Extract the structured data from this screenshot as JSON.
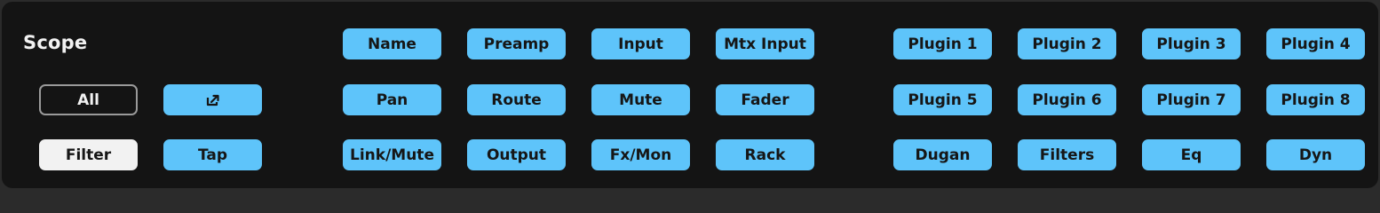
{
  "scope": {
    "title": "Scope"
  },
  "left_buttons": {
    "all": "All",
    "popout_icon": "popout-icon",
    "filter": "Filter",
    "tap": "Tap"
  },
  "grid": {
    "rows": [
      [
        "Name",
        "Preamp",
        "Input",
        "Mtx Input"
      ],
      [
        "Pan",
        "Route",
        "Mute",
        "Fader"
      ],
      [
        "Link/Mute",
        "Output",
        "Fx/Mon",
        "Rack"
      ]
    ]
  },
  "plugins": {
    "rows": [
      [
        "Plugin 1",
        "Plugin 2",
        "Plugin 3",
        "Plugin 4"
      ],
      [
        "Plugin 5",
        "Plugin 6",
        "Plugin 7",
        "Plugin 8"
      ],
      [
        "Dugan",
        "Filters",
        "Eq",
        "Dyn"
      ]
    ]
  },
  "colors": {
    "accent": "#5ec4fa",
    "panel_bg": "#141414",
    "outer_bg": "#2b2b2b",
    "text_light": "#f2f2f2",
    "text_dark": "#161616"
  }
}
